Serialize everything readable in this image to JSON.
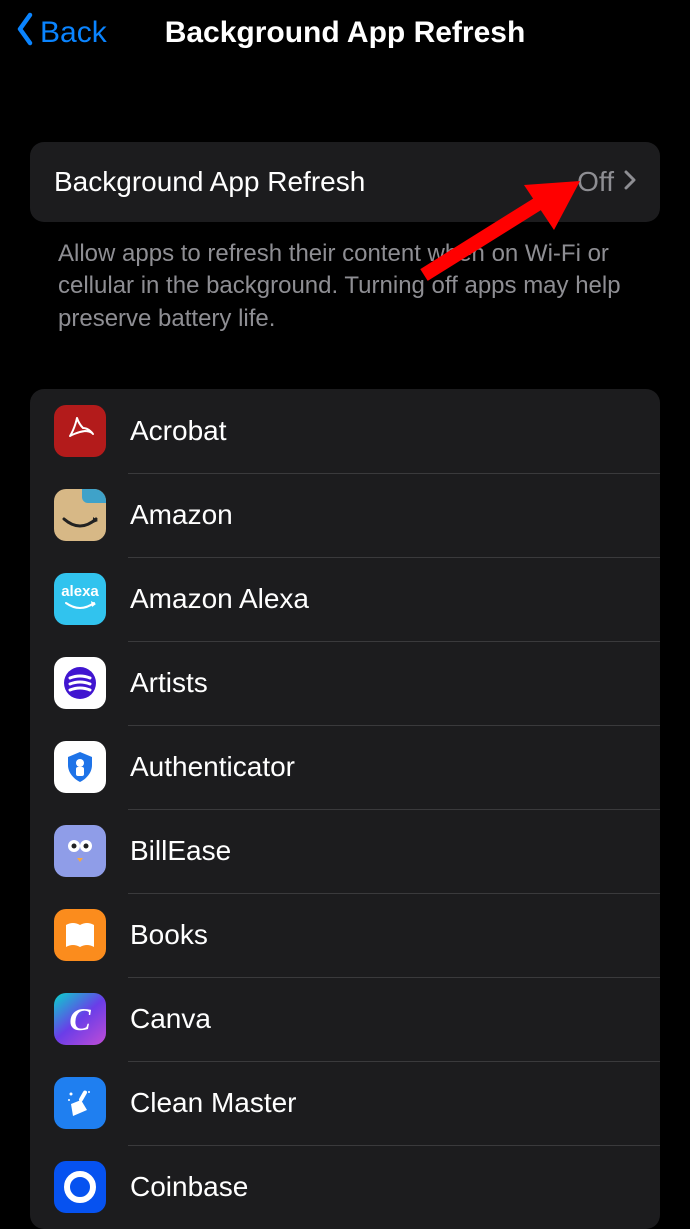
{
  "header": {
    "back_label": "Back",
    "title": "Background App Refresh"
  },
  "main_setting": {
    "label": "Background App Refresh",
    "value": "Off"
  },
  "description": "Allow apps to refresh their content when on Wi-Fi or cellular in the background. Turning off apps may help preserve battery life.",
  "apps": [
    {
      "name": "Acrobat"
    },
    {
      "name": "Amazon"
    },
    {
      "name": "Amazon Alexa"
    },
    {
      "name": "Artists"
    },
    {
      "name": "Authenticator"
    },
    {
      "name": "BillEase"
    },
    {
      "name": "Books"
    },
    {
      "name": "Canva"
    },
    {
      "name": "Clean Master"
    },
    {
      "name": "Coinbase"
    }
  ]
}
